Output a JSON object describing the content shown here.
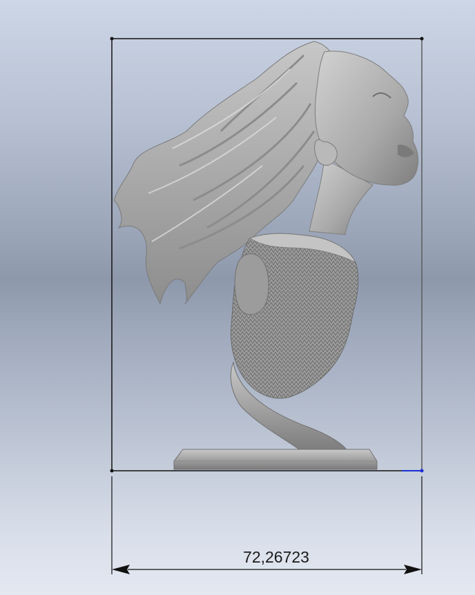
{
  "viewport": {
    "dimension": {
      "value": "72,26723"
    }
  },
  "model": {
    "name": "bust-sculpture"
  },
  "colors": {
    "sketch_line": "#111111",
    "selection_endpoint": "#1a2fd6",
    "model_gray": "#a7a7a7"
  }
}
